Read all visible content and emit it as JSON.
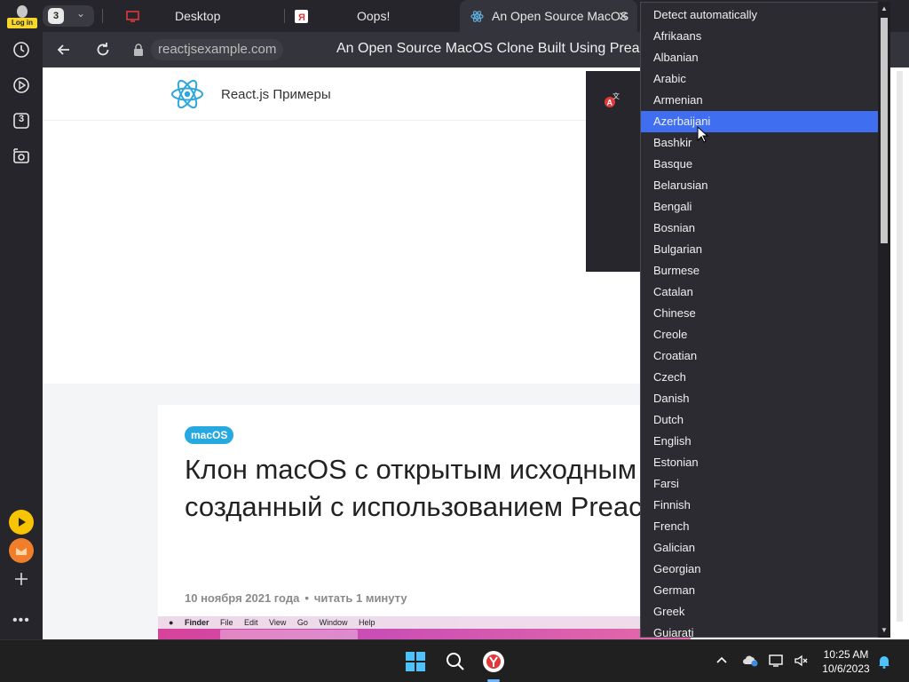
{
  "sidebar": {
    "login_label": "Log in",
    "tabs_count": "3"
  },
  "tabs": {
    "count": "3",
    "items": [
      {
        "label": "Desktop"
      },
      {
        "label": "Oops!"
      },
      {
        "label": "An Open Source MacOS"
      }
    ]
  },
  "toolbar": {
    "host": "reactjsexample.com",
    "title": "An Open Source MacOS Clone Built Using Preact"
  },
  "page": {
    "site_name": "React.js Примеры",
    "tag": "macOS",
    "title": "Клон macOS с открытым исходным кодом, созданный с использованием Preact",
    "date": "10 ноября 2021 года",
    "bullet": "•",
    "read_time": "читать 1 минуту",
    "finder_menu": [
      "Finder",
      "File",
      "Edit",
      "View",
      "Go",
      "Window",
      "Help"
    ]
  },
  "language_list": {
    "selected": "Azerbaijani",
    "items": [
      "Detect automatically",
      "Afrikaans",
      "Albanian",
      "Arabic",
      "Armenian",
      "Azerbaijani",
      "Bashkir",
      "Basque",
      "Belarusian",
      "Bengali",
      "Bosnian",
      "Bulgarian",
      "Burmese",
      "Catalan",
      "Chinese",
      "Creole",
      "Croatian",
      "Czech",
      "Danish",
      "Dutch",
      "English",
      "Estonian",
      "Farsi",
      "Finnish",
      "French",
      "Galician",
      "Georgian",
      "German",
      "Greek",
      "Gujarati"
    ]
  },
  "taskbar": {
    "time": "10:25 AM",
    "date": "10/6/2023"
  },
  "colors": {
    "accent_selected": "#3f6ef0",
    "tag_blue": "#26a8e0",
    "login_yellow": "#f5d62d"
  }
}
